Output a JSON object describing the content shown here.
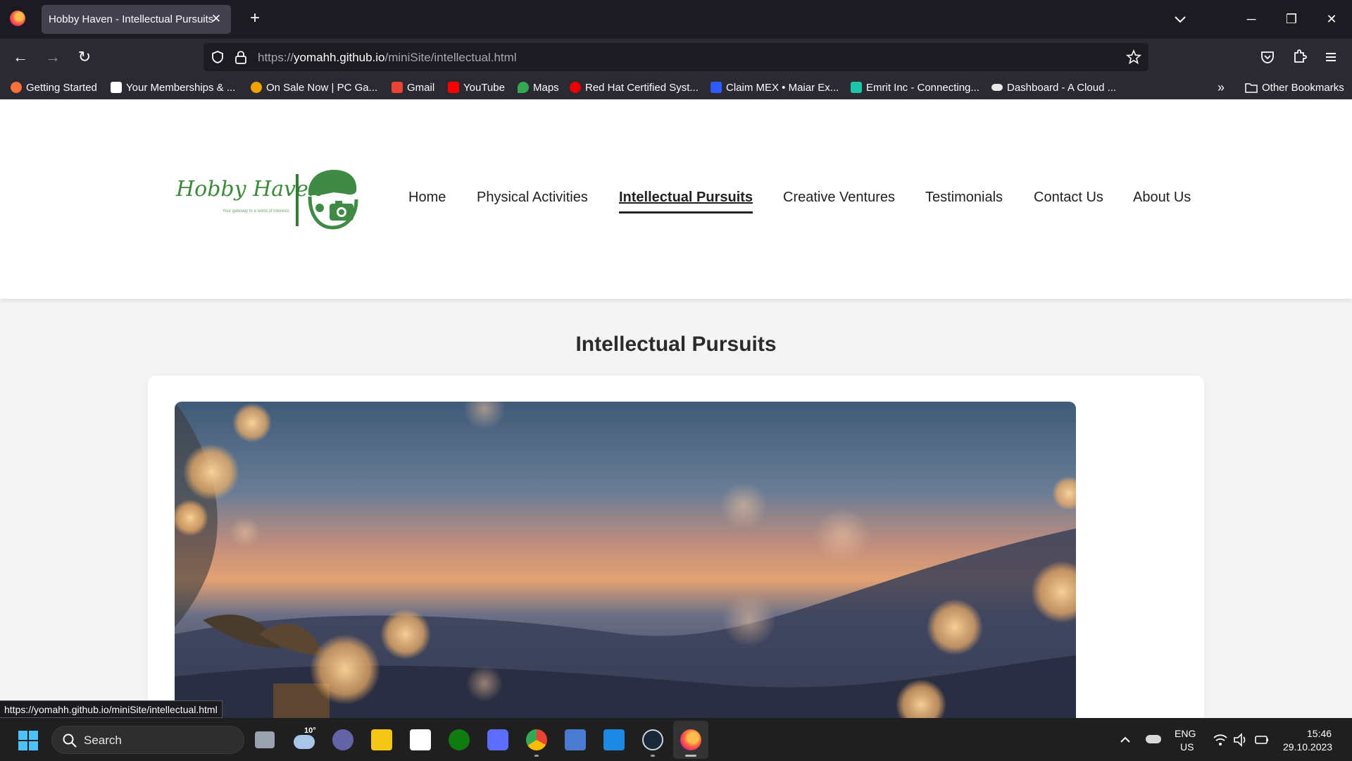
{
  "browser": {
    "tab_title": "Hobby Haven - Intellectual Pursuits",
    "url_prefix": "https://",
    "url_host": "yomahh.github.io",
    "url_path": "/miniSite/intellectual.html",
    "bookmarks": [
      {
        "label": "Getting Started",
        "color": "#ff7139"
      },
      {
        "label": "Your Memberships & ...",
        "color": "#ffffff"
      },
      {
        "label": "On Sale Now | PC Ga...",
        "color": "#f2a100"
      },
      {
        "label": "Gmail",
        "color": "#ea4335"
      },
      {
        "label": "YouTube",
        "color": "#ff0000"
      },
      {
        "label": "Maps",
        "color": "#34a853"
      },
      {
        "label": "Red Hat Certified Syst...",
        "color": "#ee0000"
      },
      {
        "label": "Claim MEX • Maiar Ex...",
        "color": "#2d5bff"
      },
      {
        "label": "Emrit Inc - Connecting...",
        "color": "#1bc5a5"
      },
      {
        "label": "Dashboard - A Cloud ...",
        "color": "#e8e8e8"
      }
    ],
    "other_bookmarks": "Other Bookmarks",
    "status_url": "https://yomahh.github.io/miniSite/intellectual.html"
  },
  "site": {
    "logo_text": "Hobby Haven",
    "logo_tagline": "Your gateway to a world of interests",
    "nav": [
      {
        "label": "Home"
      },
      {
        "label": "Physical Activities"
      },
      {
        "label": "Intellectual Pursuits",
        "active": true
      },
      {
        "label": "Creative Ventures"
      },
      {
        "label": "Testimonials"
      },
      {
        "label": "Contact Us"
      },
      {
        "label": "About Us"
      }
    ],
    "page_title": "Intellectual Pursuits"
  },
  "taskbar": {
    "search_label": "Search",
    "weather_temp": "10°",
    "lang_top": "ENG",
    "lang_bottom": "US",
    "time": "15:46",
    "date": "29.10.2023"
  }
}
